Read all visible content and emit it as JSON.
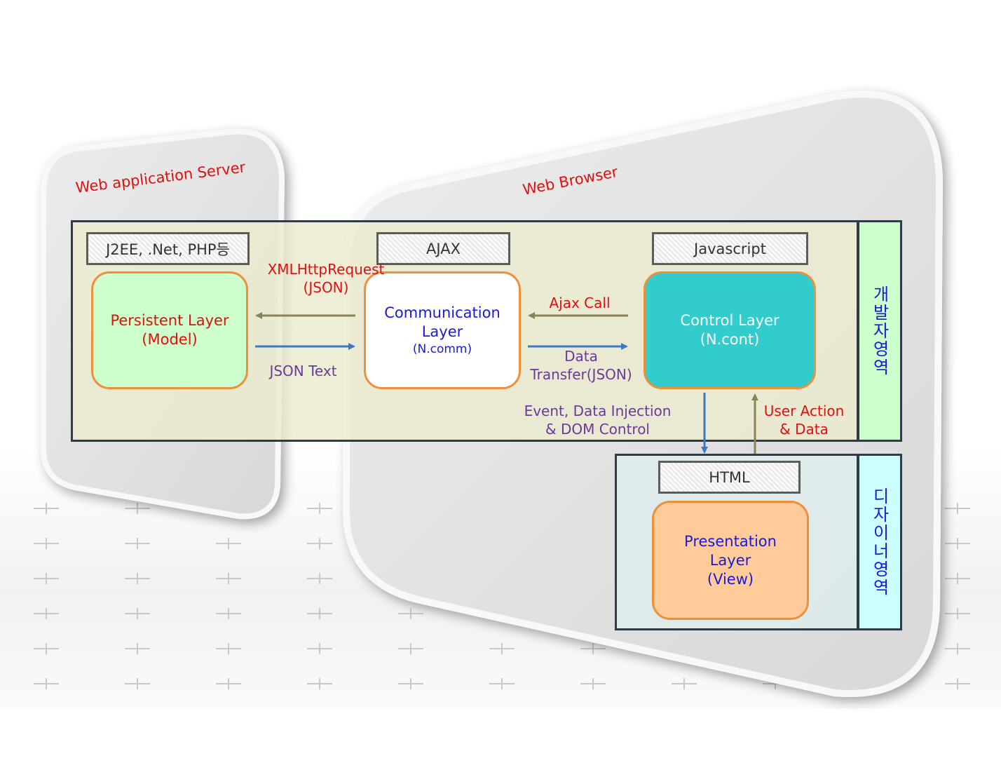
{
  "areas": {
    "server_title": "Web application Server",
    "browser_title": "Web Browser"
  },
  "tech": {
    "server": "J2EE, .Net, PHP등",
    "ajax": "AJAX",
    "javascript": "Javascript",
    "html": "HTML"
  },
  "layers": {
    "persistent": {
      "line1": "Persistent Layer",
      "line2": "(Model)"
    },
    "communication": {
      "line1": "Communication",
      "line2": "Layer",
      "line3": "(N.comm)"
    },
    "control": {
      "line1": "Control Layer",
      "line2": "(N.cont)"
    },
    "presentation": {
      "line1": "Presentation",
      "line2": "Layer",
      "line3": "(View)"
    }
  },
  "arrows": {
    "xmlhttp_line1": "XMLHttpRequest",
    "xmlhttp_line2": "(JSON)",
    "json_text": "JSON Text",
    "ajax_call": "Ajax Call",
    "data_transfer_line1": "Data",
    "data_transfer_line2": "Transfer(JSON)",
    "event_line1": "Event, Data Injection",
    "event_line2": "& DOM Control",
    "user_action_line1": "User Action",
    "user_action_line2": "& Data"
  },
  "zones": {
    "developer": "개발자영역",
    "designer": "디자이너영역"
  },
  "colors": {
    "border_dark": "#2f3b48",
    "box_orange": "#ee8f3a",
    "persistent_fill": "#ccffcc",
    "control_fill": "#33cccc",
    "presentation_fill": "#ffcc99",
    "arrow_olive": "#8a8355",
    "arrow_blue": "#3c78c8"
  }
}
